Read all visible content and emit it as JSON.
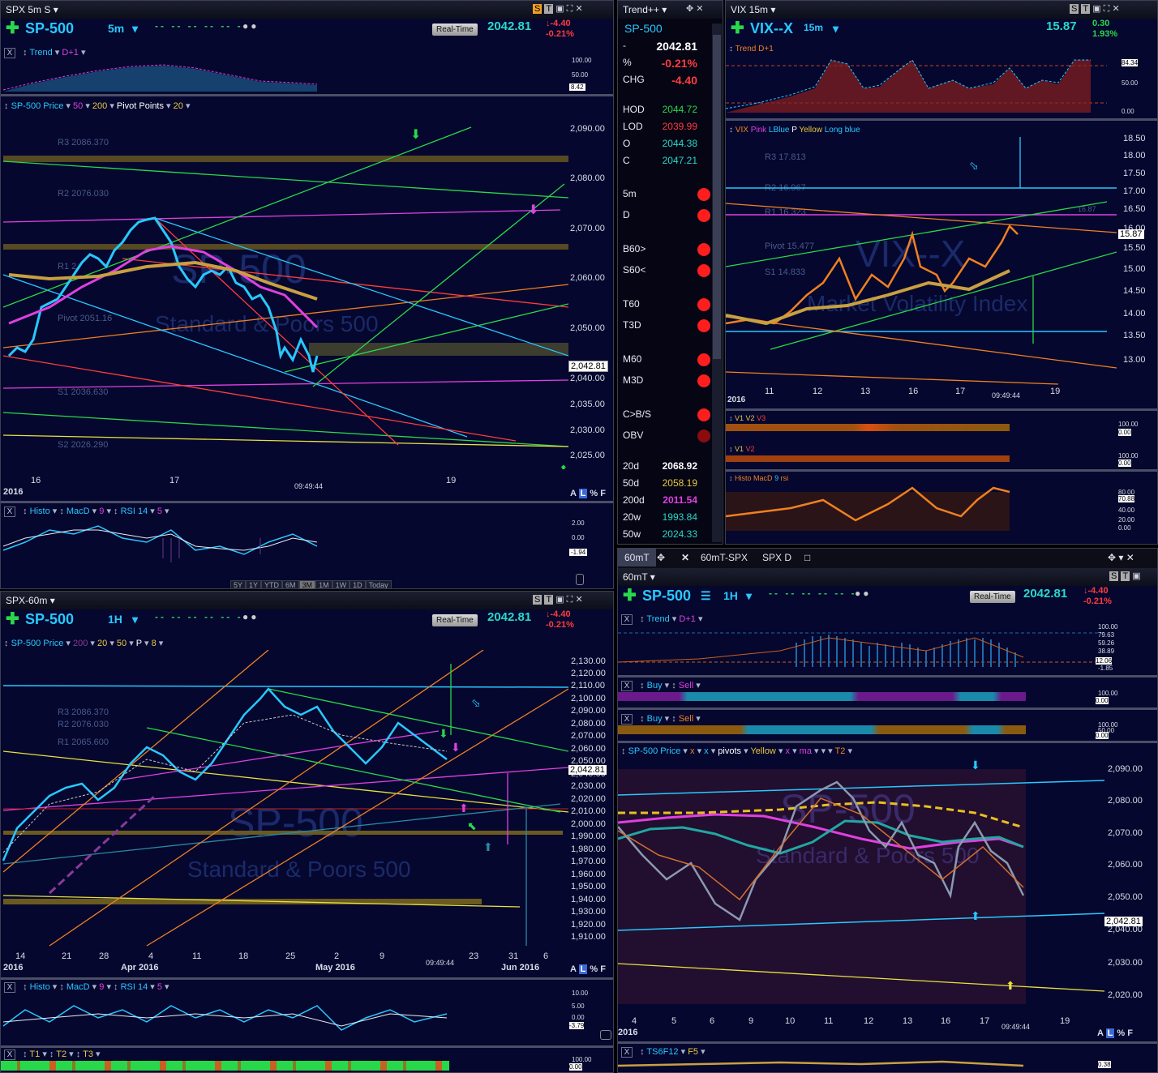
{
  "colors": {
    "bg": "#05072e",
    "cyan": "#28c8ff",
    "green": "#29d84a",
    "red": "#ff3c3c",
    "magenta": "#e040e0",
    "orange": "#f08020",
    "yellow": "#e8c840"
  },
  "icons": [
    "plus-icon",
    "dropdown-icon",
    "menu-icon",
    "binoculars-icon",
    "close-icon",
    "minimize-icon",
    "maximize-icon",
    "move-icon",
    "pin-icon",
    "arrow-down-icon",
    "scroll-icon"
  ],
  "win1": {
    "title": "SPX 5m S",
    "symbol": "SP-500",
    "timeframe": "5m",
    "realtime": "Real-Time",
    "last": "2042.81",
    "change": "-4.40",
    "change_pct": "-0.21%",
    "trend_label": "Trend",
    "trend_param": "D+1",
    "trend_axis": [
      "100.00",
      "50.00",
      "8.42"
    ],
    "price_label": "SP-500 Price",
    "p1": "50",
    "p2": "200",
    "pivot_label": "Pivot Points",
    "p3": "20",
    "levels": [
      "R3 2086.370",
      "R2 2076.030",
      "R1 2",
      "Pivot 2051.16",
      "S1 2036.630",
      "S2 2026.290"
    ],
    "watermark": "SP-500",
    "watermark_sub": "Standard & Poors 500",
    "price_axis": [
      "2,090.00",
      "2,080.00",
      "2,070.00",
      "2,060.00",
      "2,050.00",
      "2,040.00",
      "2,035.00",
      "2,030.00",
      "2,025.00"
    ],
    "price_tag": "2,042.81",
    "dates": [
      "16",
      "17",
      "19"
    ],
    "year": "2016",
    "time": "09:49:44",
    "afl": [
      "A",
      "L",
      "%",
      "F"
    ],
    "histo_label": "Histo",
    "macd_label": "MacD",
    "macd_param": "9",
    "rsi_label": "RSI 14",
    "rsi_param": "5",
    "histo_axis": [
      "2.00",
      "0.00",
      "-1.94"
    ],
    "periods": [
      "5Y",
      "1Y",
      "YTD",
      "6M",
      "3M",
      "1M",
      "1W",
      "1D",
      "Today"
    ]
  },
  "quote": {
    "title": "Trend++",
    "symbol": "SP-500",
    "rows": [
      {
        "label": "-",
        "value": "2042.81",
        "color": "#ffffff"
      },
      {
        "label": "%",
        "value": "-0.21%",
        "color": "#ff3c3c"
      },
      {
        "label": "CHG",
        "value": "-4.40",
        "color": "#ff3c3c"
      },
      {
        "label": "HOD",
        "value": "2044.72",
        "color": "#29d84a"
      },
      {
        "label": "LOD",
        "value": "2039.99",
        "color": "#ff3c3c"
      },
      {
        "label": "O",
        "value": "2044.38",
        "color": "#29d8c8"
      },
      {
        "label": "C",
        "value": "2047.21",
        "color": "#29d8c8"
      }
    ],
    "signals": [
      "5m",
      "D",
      "B60>",
      "S60<",
      "T60",
      "T3D",
      "M60",
      "M3D",
      "C>B/S",
      "OBV"
    ],
    "mas": [
      {
        "label": "20d",
        "value": "2068.92",
        "color": "#ffffff"
      },
      {
        "label": "50d",
        "value": "2058.19",
        "color": "#e8c840"
      },
      {
        "label": "200d",
        "value": "2011.54",
        "color": "#e040e0"
      },
      {
        "label": "20w",
        "value": "1993.84",
        "color": "#29d8c8"
      },
      {
        "label": "50w",
        "value": "2024.33",
        "color": "#29d8c8"
      }
    ]
  },
  "vix": {
    "title": "VIX 15m",
    "symbol": "VIX--X",
    "timeframe": "15m",
    "last": "15.87",
    "change": "0.30",
    "change_pct": "1.93%",
    "trend_label": "Trend",
    "trend_param": "D+1",
    "trend_axis": [
      "84.34",
      "50.00",
      "0.00"
    ],
    "price_labels": [
      "VIX",
      "Pink",
      "LBlue",
      "P",
      "Yellow",
      "Long blue"
    ],
    "levels": [
      "R3 17.813",
      "R2 16.967",
      "R1 16.323",
      "Pivot 15.477",
      "S1 14.833"
    ],
    "watermark": "VIX--X",
    "watermark_sub": "Market Volatility Index",
    "price_axis": [
      "18.50",
      "18.00",
      "17.50",
      "17.00",
      "16.50",
      "16.00",
      "15.50",
      "15.00",
      "14.50",
      "14.00",
      "13.50",
      "13.00"
    ],
    "price_tag": "15.87",
    "r_tag": "16.87",
    "dates": [
      "11",
      "12",
      "13",
      "16",
      "17",
      "19"
    ],
    "year": "2016",
    "time": "09:49:44",
    "v_labels": [
      "V1",
      "V2",
      "V3"
    ],
    "v_axis": [
      "100.00",
      "0.00"
    ],
    "histo_label": "Histo",
    "macd_label": "MacD",
    "macd_param": "9",
    "rsi_label": "rsi",
    "histo_axis": [
      "80.00",
      "70.88",
      "40.00",
      "20.00",
      "0.00"
    ]
  },
  "win3": {
    "title": "SPX-60m",
    "symbol": "SP-500",
    "timeframe": "1H",
    "realtime": "Real-Time",
    "last": "2042.81",
    "change": "-4.40",
    "change_pct": "-0.21%",
    "price_label": "SP-500 Price",
    "p1": "200",
    "p2": "20",
    "p3": "50",
    "p4": "P",
    "p5": "8",
    "levels": [
      "R3 2086.370",
      "R2 2076.030",
      "R1 2065.600"
    ],
    "watermark": "SP-500",
    "watermark_sub": "Standard & Poors 500",
    "price_axis": [
      "2,130.00",
      "2,120.00",
      "2,110.00",
      "2,100.00",
      "2,090.00",
      "2,080.00",
      "2,070.00",
      "2,060.00",
      "2,050.00",
      "2,040.00",
      "2,030.00",
      "2,020.00",
      "2,010.00",
      "2,000.00",
      "1,990.00",
      "1,980.00",
      "1,970.00",
      "1,960.00",
      "1,950.00",
      "1,940.00",
      "1,930.00",
      "1,920.00",
      "1,910.00"
    ],
    "price_tag": "2,042.81",
    "dates": [
      "14",
      "21",
      "28",
      "Apr 2016",
      "11",
      "18",
      "25",
      "2",
      "May 2016",
      "9",
      "23",
      "31",
      "6",
      "Jun 2016",
      "4",
      "2016"
    ],
    "date_main": [
      "14",
      "21",
      "28",
      "4",
      "11",
      "18",
      "25",
      "2",
      "9",
      "23",
      "31",
      "6"
    ],
    "date_sub": [
      "2016",
      "Apr 2016",
      "May 2016",
      "Jun 2016"
    ],
    "time": "09:49:44",
    "histo_label": "Histo",
    "macd_label": "MacD",
    "macd_param": "9",
    "rsi_label": "RSI 14",
    "rsi_param": "5",
    "histo_axis": [
      "10.00",
      "5.00",
      "0.00",
      "-3.79"
    ],
    "t_labels": [
      "T1",
      "T2",
      "T3"
    ],
    "t_axis": [
      "100.00",
      "0.00"
    ]
  },
  "win4": {
    "tabs": [
      "60mT",
      "60mT-SPX",
      "SPX D"
    ],
    "title": "60mT",
    "symbol": "SP-500",
    "timeframe": "1H",
    "realtime": "Real-Time",
    "last": "2042.81",
    "change": "-4.40",
    "change_pct": "-0.21%",
    "trend_label": "Trend",
    "trend_param": "D+1",
    "trend_axis": [
      "100.00",
      "79.63",
      "59.26",
      "38.89",
      "12.06",
      "-1.85"
    ],
    "buy_label": "Buy",
    "sell_label": "Sell",
    "bs_axis": [
      "100.00",
      "50.00",
      "0.00"
    ],
    "price_label": "SP-500 Price",
    "px1": "x",
    "px2": "x",
    "pivots_label": "pivots",
    "pcolor": "Yellow",
    "px3": "x",
    "ma_label": "ma",
    "t2": "T2",
    "watermark": "SP-500",
    "watermark_sub": "Standard & Poors 500",
    "price_axis": [
      "2,090.00",
      "2,080.00",
      "2,070.00",
      "2,060.00",
      "2,050.00",
      "2,040.00",
      "2,030.00",
      "2,020.00"
    ],
    "price_tag": "2,042.81",
    "dates": [
      "4",
      "5",
      "6",
      "9",
      "10",
      "11",
      "12",
      "13",
      "16",
      "17",
      "19"
    ],
    "year": "2016",
    "time": "09:49:44",
    "ts_label": "TS6F12",
    "ts_param": "F5",
    "ts_axis": [
      "0.38"
    ]
  }
}
